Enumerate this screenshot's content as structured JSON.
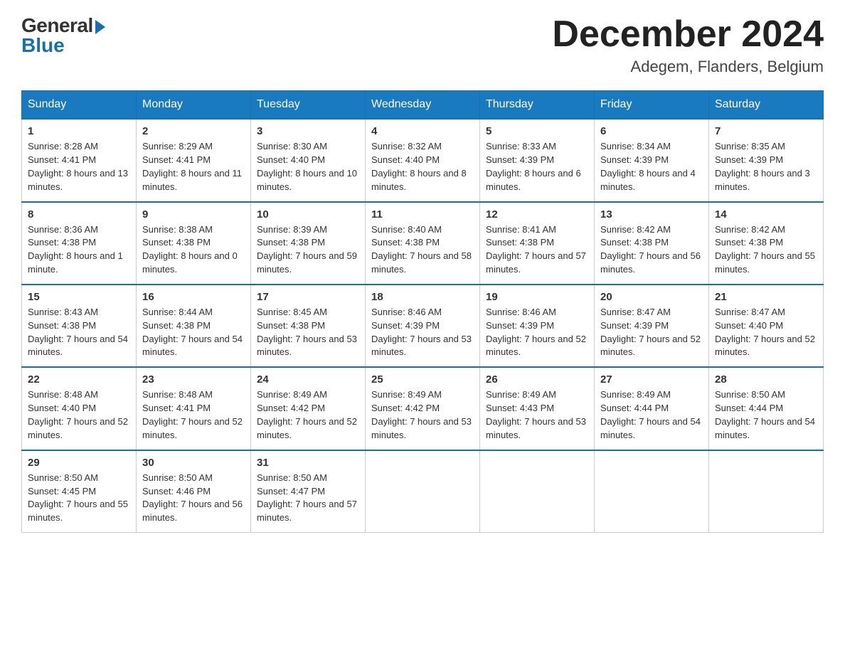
{
  "header": {
    "logo_general": "General",
    "logo_blue": "Blue",
    "month_year": "December 2024",
    "location": "Adegem, Flanders, Belgium"
  },
  "days_of_week": [
    "Sunday",
    "Monday",
    "Tuesday",
    "Wednesday",
    "Thursday",
    "Friday",
    "Saturday"
  ],
  "weeks": [
    [
      {
        "num": "1",
        "sunrise": "8:28 AM",
        "sunset": "4:41 PM",
        "daylight": "8 hours and 13 minutes."
      },
      {
        "num": "2",
        "sunrise": "8:29 AM",
        "sunset": "4:41 PM",
        "daylight": "8 hours and 11 minutes."
      },
      {
        "num": "3",
        "sunrise": "8:30 AM",
        "sunset": "4:40 PM",
        "daylight": "8 hours and 10 minutes."
      },
      {
        "num": "4",
        "sunrise": "8:32 AM",
        "sunset": "4:40 PM",
        "daylight": "8 hours and 8 minutes."
      },
      {
        "num": "5",
        "sunrise": "8:33 AM",
        "sunset": "4:39 PM",
        "daylight": "8 hours and 6 minutes."
      },
      {
        "num": "6",
        "sunrise": "8:34 AM",
        "sunset": "4:39 PM",
        "daylight": "8 hours and 4 minutes."
      },
      {
        "num": "7",
        "sunrise": "8:35 AM",
        "sunset": "4:39 PM",
        "daylight": "8 hours and 3 minutes."
      }
    ],
    [
      {
        "num": "8",
        "sunrise": "8:36 AM",
        "sunset": "4:38 PM",
        "daylight": "8 hours and 1 minute."
      },
      {
        "num": "9",
        "sunrise": "8:38 AM",
        "sunset": "4:38 PM",
        "daylight": "8 hours and 0 minutes."
      },
      {
        "num": "10",
        "sunrise": "8:39 AM",
        "sunset": "4:38 PM",
        "daylight": "7 hours and 59 minutes."
      },
      {
        "num": "11",
        "sunrise": "8:40 AM",
        "sunset": "4:38 PM",
        "daylight": "7 hours and 58 minutes."
      },
      {
        "num": "12",
        "sunrise": "8:41 AM",
        "sunset": "4:38 PM",
        "daylight": "7 hours and 57 minutes."
      },
      {
        "num": "13",
        "sunrise": "8:42 AM",
        "sunset": "4:38 PM",
        "daylight": "7 hours and 56 minutes."
      },
      {
        "num": "14",
        "sunrise": "8:42 AM",
        "sunset": "4:38 PM",
        "daylight": "7 hours and 55 minutes."
      }
    ],
    [
      {
        "num": "15",
        "sunrise": "8:43 AM",
        "sunset": "4:38 PM",
        "daylight": "7 hours and 54 minutes."
      },
      {
        "num": "16",
        "sunrise": "8:44 AM",
        "sunset": "4:38 PM",
        "daylight": "7 hours and 54 minutes."
      },
      {
        "num": "17",
        "sunrise": "8:45 AM",
        "sunset": "4:38 PM",
        "daylight": "7 hours and 53 minutes."
      },
      {
        "num": "18",
        "sunrise": "8:46 AM",
        "sunset": "4:39 PM",
        "daylight": "7 hours and 53 minutes."
      },
      {
        "num": "19",
        "sunrise": "8:46 AM",
        "sunset": "4:39 PM",
        "daylight": "7 hours and 52 minutes."
      },
      {
        "num": "20",
        "sunrise": "8:47 AM",
        "sunset": "4:39 PM",
        "daylight": "7 hours and 52 minutes."
      },
      {
        "num": "21",
        "sunrise": "8:47 AM",
        "sunset": "4:40 PM",
        "daylight": "7 hours and 52 minutes."
      }
    ],
    [
      {
        "num": "22",
        "sunrise": "8:48 AM",
        "sunset": "4:40 PM",
        "daylight": "7 hours and 52 minutes."
      },
      {
        "num": "23",
        "sunrise": "8:48 AM",
        "sunset": "4:41 PM",
        "daylight": "7 hours and 52 minutes."
      },
      {
        "num": "24",
        "sunrise": "8:49 AM",
        "sunset": "4:42 PM",
        "daylight": "7 hours and 52 minutes."
      },
      {
        "num": "25",
        "sunrise": "8:49 AM",
        "sunset": "4:42 PM",
        "daylight": "7 hours and 53 minutes."
      },
      {
        "num": "26",
        "sunrise": "8:49 AM",
        "sunset": "4:43 PM",
        "daylight": "7 hours and 53 minutes."
      },
      {
        "num": "27",
        "sunrise": "8:49 AM",
        "sunset": "4:44 PM",
        "daylight": "7 hours and 54 minutes."
      },
      {
        "num": "28",
        "sunrise": "8:50 AM",
        "sunset": "4:44 PM",
        "daylight": "7 hours and 54 minutes."
      }
    ],
    [
      {
        "num": "29",
        "sunrise": "8:50 AM",
        "sunset": "4:45 PM",
        "daylight": "7 hours and 55 minutes."
      },
      {
        "num": "30",
        "sunrise": "8:50 AM",
        "sunset": "4:46 PM",
        "daylight": "7 hours and 56 minutes."
      },
      {
        "num": "31",
        "sunrise": "8:50 AM",
        "sunset": "4:47 PM",
        "daylight": "7 hours and 57 minutes."
      },
      null,
      null,
      null,
      null
    ]
  ],
  "labels": {
    "sunrise": "Sunrise:",
    "sunset": "Sunset:",
    "daylight": "Daylight:"
  }
}
